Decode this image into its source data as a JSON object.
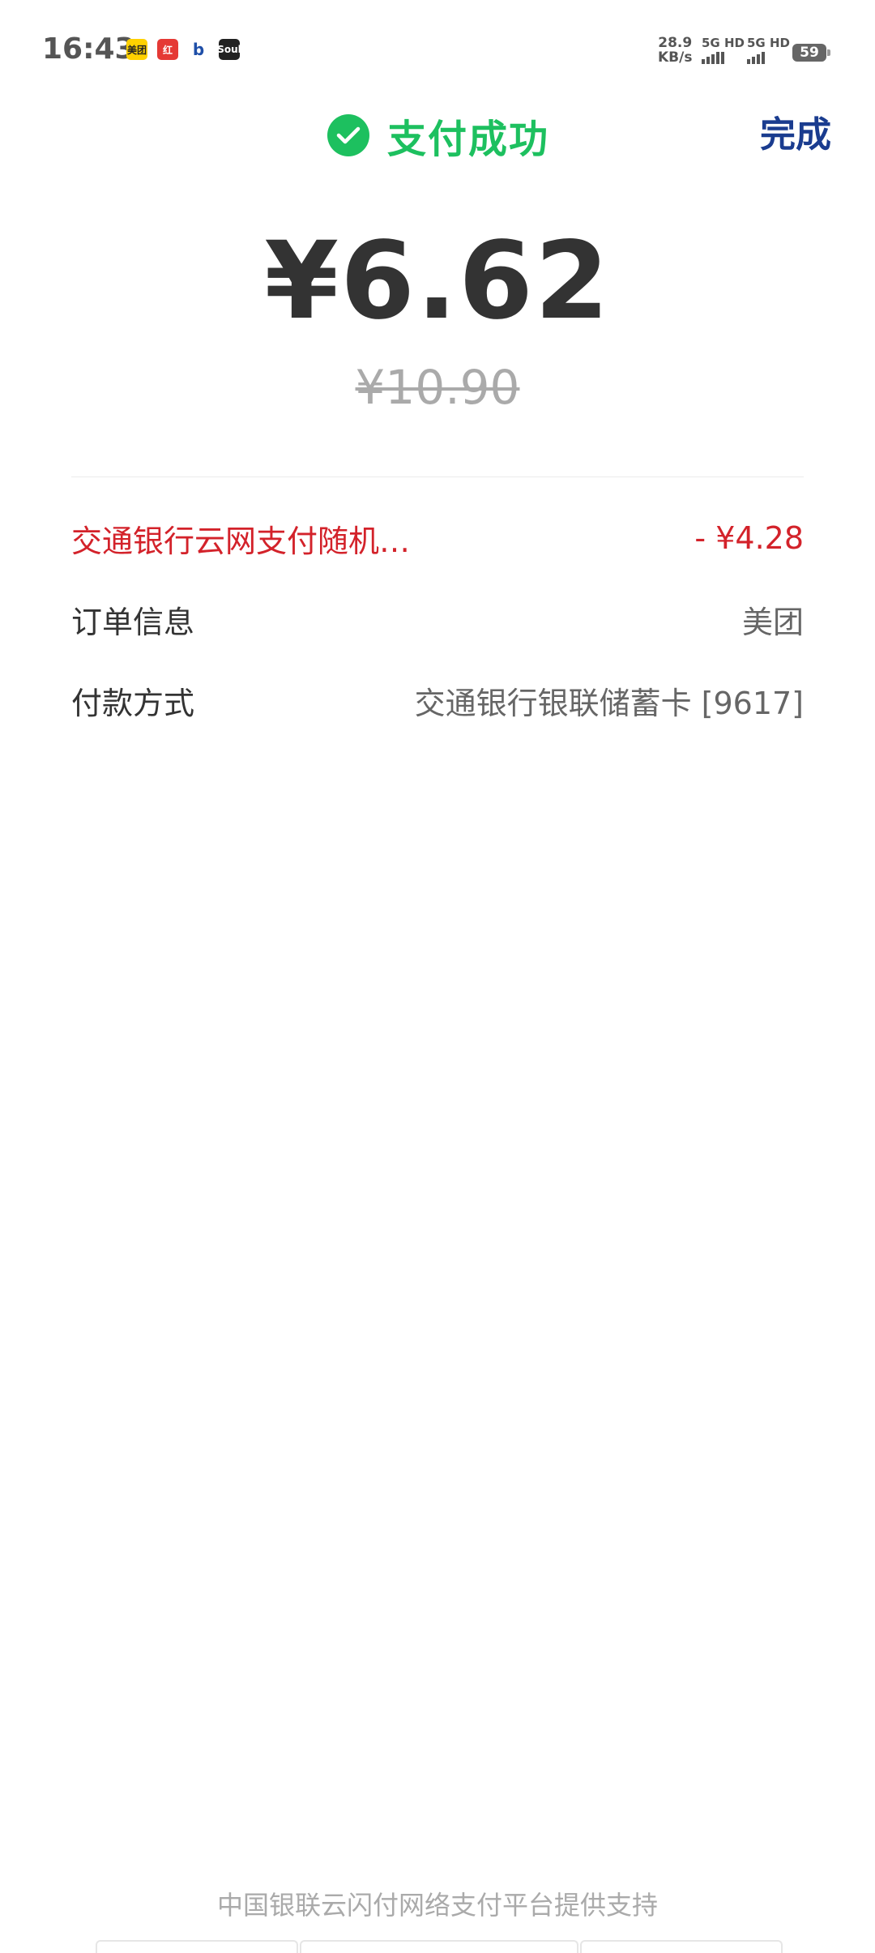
{
  "status_bar": {
    "time": "16:43",
    "notification_icons": [
      "美团",
      "红",
      "b",
      "Soul"
    ],
    "net_speed_value": "28.9",
    "net_speed_unit": "KB/s",
    "sim1": "5G HD",
    "sim2": "5G HD",
    "battery": "59"
  },
  "header": {
    "title": "支付成功",
    "done_label": "完成"
  },
  "payment": {
    "amount": "¥6.62",
    "original_amount": "¥10.90"
  },
  "details": [
    {
      "label": "交通银行云网支付随机…",
      "value": "- ¥4.28"
    },
    {
      "label": "订单信息",
      "value": "美团"
    },
    {
      "label": "付款方式",
      "value": "交通银行银联储蓄卡 [9617]"
    }
  ],
  "footer": {
    "text": "中国银联云闪付网络支付平台提供支持"
  },
  "colors": {
    "success": "#1dc05f",
    "link": "#1a3c8f",
    "discount": "#d3222a"
  }
}
